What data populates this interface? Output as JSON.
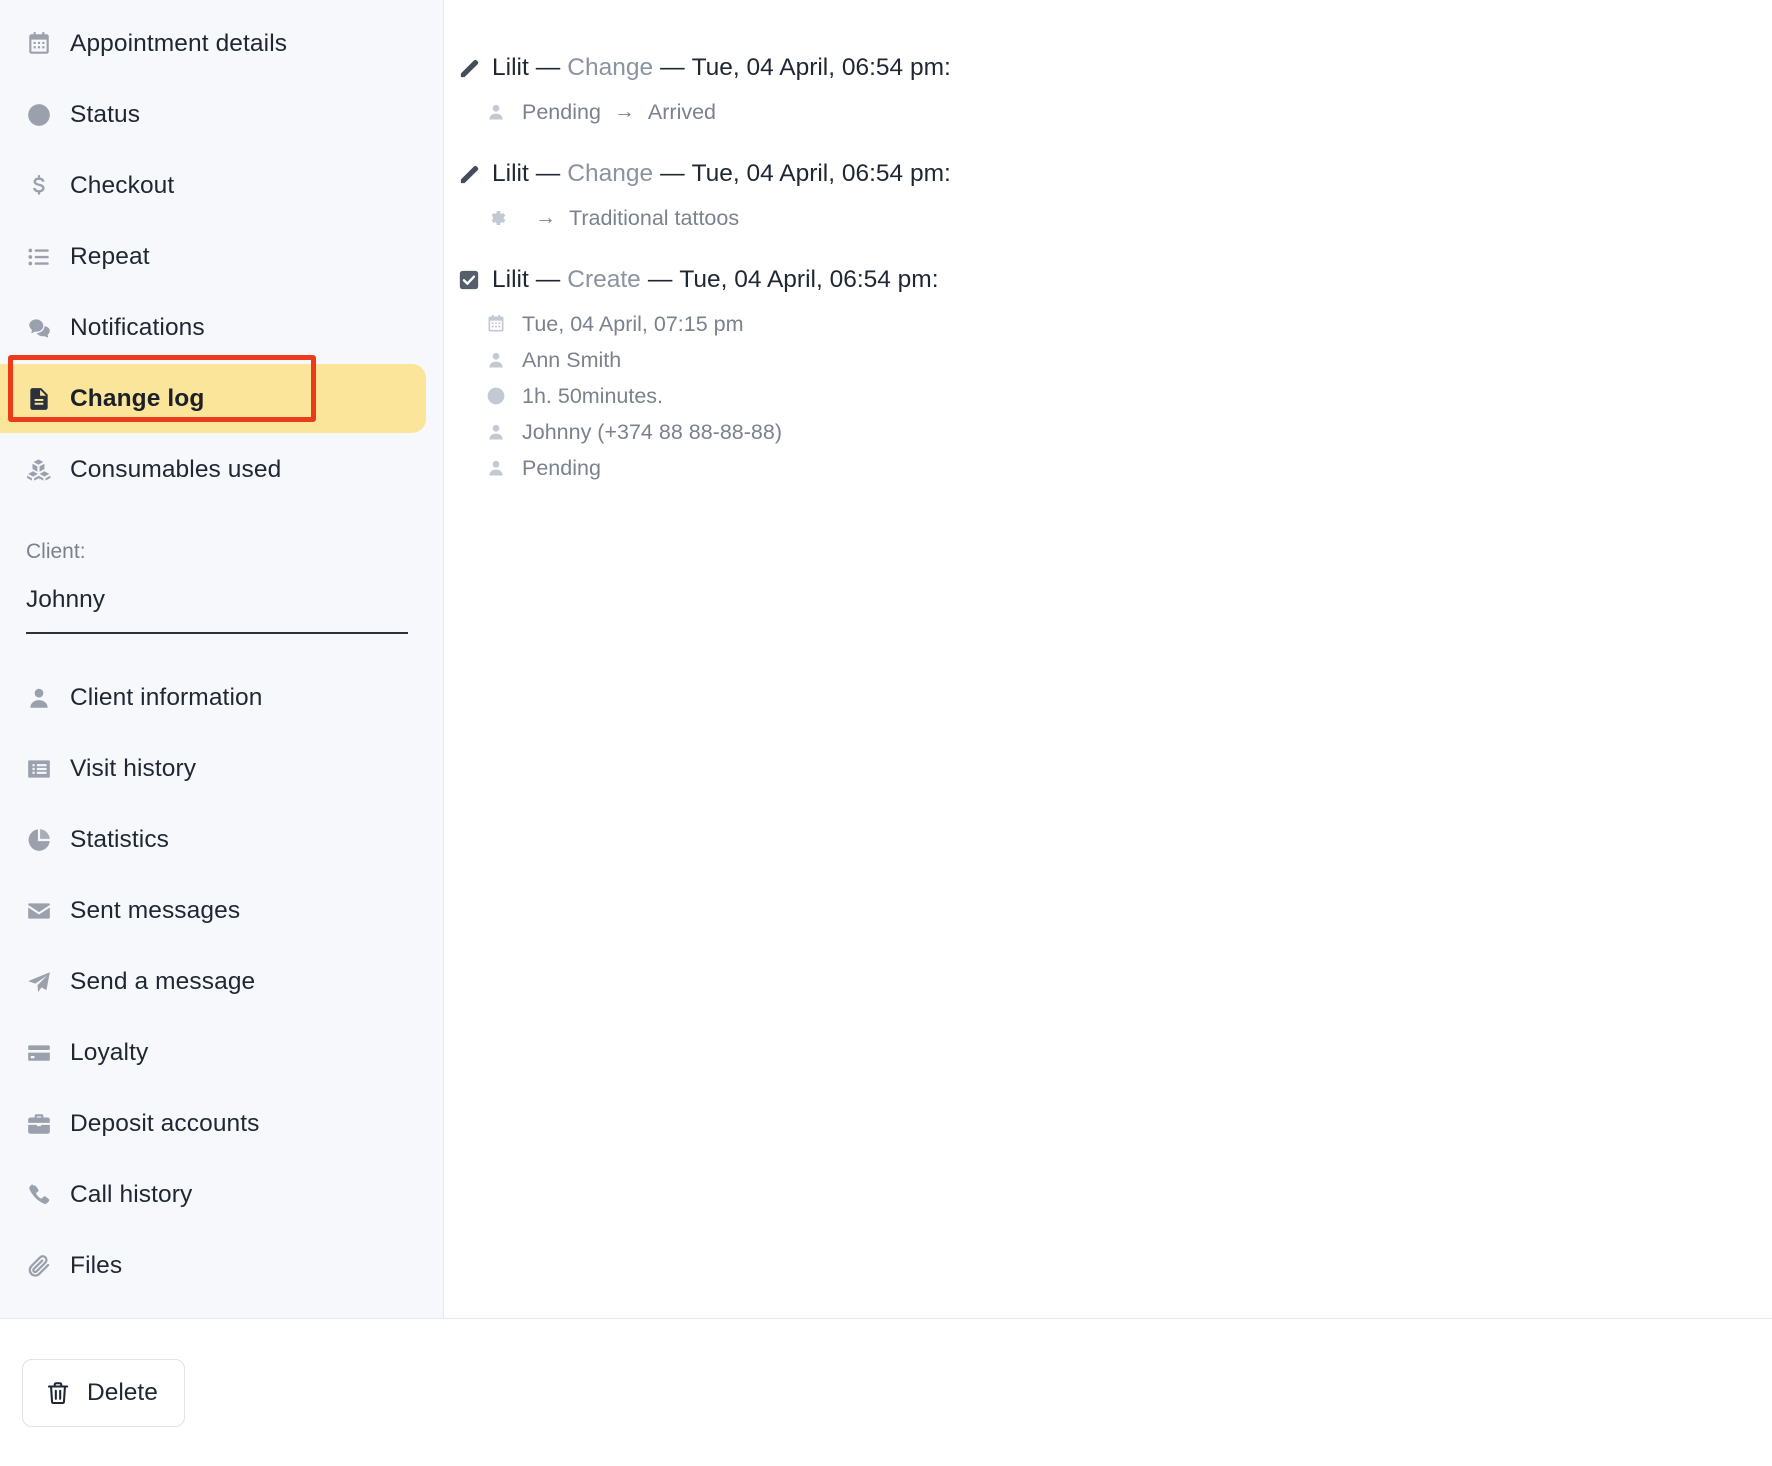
{
  "sidebar": {
    "primary_items": [
      {
        "label": "Appointment details",
        "icon": "calendar-icon",
        "active": false
      },
      {
        "label": "Status",
        "icon": "clock-icon",
        "active": false
      },
      {
        "label": "Checkout",
        "icon": "dollar-icon",
        "active": false
      },
      {
        "label": "Repeat",
        "icon": "list-icon",
        "active": false
      },
      {
        "label": "Notifications",
        "icon": "chat-bubbles-icon",
        "active": false
      },
      {
        "label": "Change log",
        "icon": "document-icon",
        "active": true
      },
      {
        "label": "Consumables used",
        "icon": "boxes-icon",
        "active": false
      }
    ],
    "client_field": {
      "label": "Client:",
      "value": "Johnny"
    },
    "secondary_items": [
      {
        "label": "Client information",
        "icon": "person-icon"
      },
      {
        "label": "Visit history",
        "icon": "list-box-icon"
      },
      {
        "label": "Statistics",
        "icon": "pie-chart-icon"
      },
      {
        "label": "Sent messages",
        "icon": "envelope-icon"
      },
      {
        "label": "Send a message",
        "icon": "paper-plane-icon"
      },
      {
        "label": "Loyalty",
        "icon": "credit-card-icon"
      },
      {
        "label": "Deposit accounts",
        "icon": "briefcase-icon"
      },
      {
        "label": "Call history",
        "icon": "phone-icon"
      },
      {
        "label": "Files",
        "icon": "paperclip-icon"
      }
    ],
    "highlight_color": "#fbe59a",
    "annotation_color": "#ec3b1b"
  },
  "change_log": {
    "entries": [
      {
        "icon": "pencil-icon",
        "author": "Lilit",
        "action": "Change",
        "timestamp": "Tue, 04 April, 06:54 pm:",
        "separator": "—",
        "details": [
          {
            "icon": "person-icon",
            "from": "Pending",
            "arrow": "→",
            "to": "Arrived"
          }
        ]
      },
      {
        "icon": "pencil-icon",
        "author": "Lilit",
        "action": "Change",
        "timestamp": "Tue, 04 April, 06:54 pm:",
        "separator": "—",
        "details": [
          {
            "icon": "gear-icon",
            "from": "",
            "arrow": "→",
            "to": "Traditional tattoos"
          }
        ]
      },
      {
        "icon": "checkbox-checked-icon",
        "author": "Lilit",
        "action": "Create",
        "timestamp": "Tue, 04 April, 06:54 pm:",
        "separator": "—",
        "details": [
          {
            "icon": "calendar-icon",
            "text": "Tue, 04 April, 07:15 pm"
          },
          {
            "icon": "person-icon",
            "text": "Ann Smith"
          },
          {
            "icon": "clock-icon",
            "text": "1h. 50minutes."
          },
          {
            "icon": "person-icon",
            "text": "Johnny (+374 88 88-88-88)"
          },
          {
            "icon": "person-icon",
            "text": "Pending"
          }
        ]
      }
    ]
  },
  "footer": {
    "delete_label": "Delete",
    "delete_icon": "trash-icon"
  }
}
